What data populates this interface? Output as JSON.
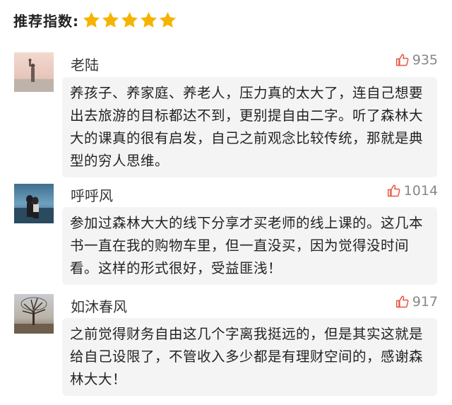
{
  "rating": {
    "label": "推荐指数:",
    "stars": 5,
    "star_color": "#f5b400"
  },
  "comments": [
    {
      "username": "老陆",
      "likes": "935",
      "text": "养孩子、养家庭、养老人，压力真的太大了，连自己想要出去旅游的目标都达不到，更别提自由二字。听了森林大大的课真的很有启发，自己之前观念比较传统，那就是典型的穷人思维。",
      "avatar_icon": "beach-photo"
    },
    {
      "username": "呼呼风",
      "likes": "1014",
      "text": "参加过森林大大的线下分享才买老师的线上课的。这几本书一直在我的购物车里，但一直没买，因为觉得没时间看。这样的形式很好，受益匪浅！",
      "avatar_icon": "couple-photo"
    },
    {
      "username": "如沐春风",
      "likes": "917",
      "text": "之前觉得财务自由这几个字离我挺远的，但是其实这就是给自己设限了，不管收入多少都是有理财空间的，感谢森林大大！",
      "avatar_icon": "tree-photo"
    }
  ],
  "colors": {
    "thumb": "#e8543f",
    "bubble_bg": "#f4f4f4"
  }
}
